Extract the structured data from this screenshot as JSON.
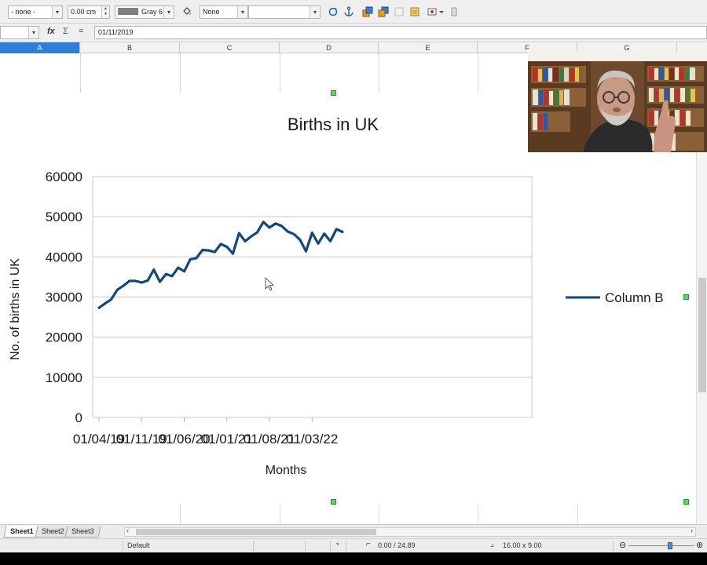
{
  "toolbar": {
    "line_style": "- none -",
    "line_width": "0.00 cm",
    "line_color": "Gray 6",
    "area_style": "None",
    "area_fill": ""
  },
  "formula_bar": {
    "cell_ref": "",
    "fx_label": "fx",
    "sum_label": "Σ",
    "equals_label": "=",
    "content": "01/11/2019"
  },
  "columns": [
    "A",
    "B",
    "C",
    "D",
    "E",
    "F",
    "G"
  ],
  "colors": {
    "series": "#12477f",
    "active_column": "#2e7fd8",
    "handle": "#5cd65c"
  },
  "chart_data": {
    "type": "line",
    "title": "Births in UK",
    "xlabel": "Months",
    "ylabel": "No. of births in UK",
    "ylim": [
      0,
      60000
    ],
    "yticks": [
      "60000",
      "50000",
      "40000",
      "30000",
      "20000",
      "10000",
      "0"
    ],
    "xtick_labels": [
      "01/04/19",
      "01/11/19",
      "01/06/20",
      "01/01/21",
      "01/08/21",
      "01/03/22"
    ],
    "grid": true,
    "legend_position": "right",
    "series": [
      {
        "name": "Column B",
        "values": [
          27300,
          28400,
          29400,
          31800,
          32800,
          34000,
          34000,
          33600,
          34100,
          36800,
          33800,
          35700,
          35200,
          37300,
          36400,
          39400,
          39700,
          41700,
          41600,
          41200,
          43200,
          42500,
          40800,
          45900,
          43900,
          45100,
          46100,
          48700,
          47300,
          48300,
          47700,
          46300,
          45700,
          44300,
          41400,
          46000,
          43300,
          45800,
          43900,
          46900,
          46200
        ]
      }
    ]
  },
  "sheet_tabs": [
    "Sheet1",
    "Sheet2",
    "Sheet3"
  ],
  "status": {
    "page_style": "Default",
    "modified": "*",
    "position": "0.00 / 24.89",
    "size": "16.00 x 9.00"
  }
}
